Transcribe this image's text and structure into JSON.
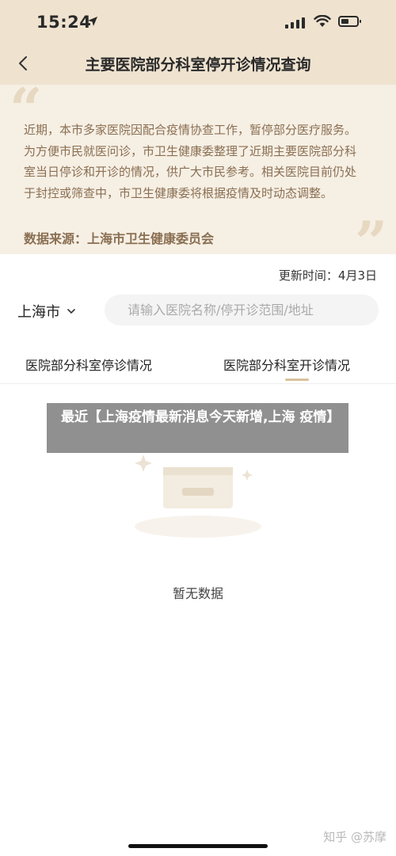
{
  "status_bar": {
    "time": "15:24",
    "icons": [
      "location-arrow-icon",
      "signal-icon",
      "wifi-icon",
      "battery-icon"
    ]
  },
  "nav": {
    "title": "主要医院部分科室停开诊情况查询",
    "back_icon": "chevron-left-icon"
  },
  "notice": {
    "text": "近期，本市多家医院因配合疫情协查工作，暂停部分医疗服务。为方便市民就医问诊，市卫生健康委整理了近期主要医院部分科室当日停诊和开诊的情况，供广大市民参考。相关医院目前仍处于封控或筛查中，市卫生健康委将根据疫情及时动态调整。",
    "source": "数据来源：上海市卫生健康委员会",
    "quote_open": "“",
    "quote_close": "”"
  },
  "update": {
    "label": "更新时间：4月3日"
  },
  "filter": {
    "city": "上海市",
    "search_placeholder": "请输入医院名称/停开诊范围/地址"
  },
  "tabs": [
    {
      "label": "医院部分科室停诊情况",
      "active": false
    },
    {
      "label": "医院部分科室开诊情况",
      "active": true
    }
  ],
  "empty_state": {
    "text": "暂无数据"
  },
  "overlay": {
    "text": "最近【上海疫情最新消息今天新增,上海 疫情】"
  },
  "watermark": {
    "text": "知乎 @苏摩"
  },
  "colors": {
    "header_bg": "#efe3d0",
    "notice_bg": "#f6efe4",
    "notice_text": "#8a6f52",
    "tab_accent": "#d9c19c"
  }
}
